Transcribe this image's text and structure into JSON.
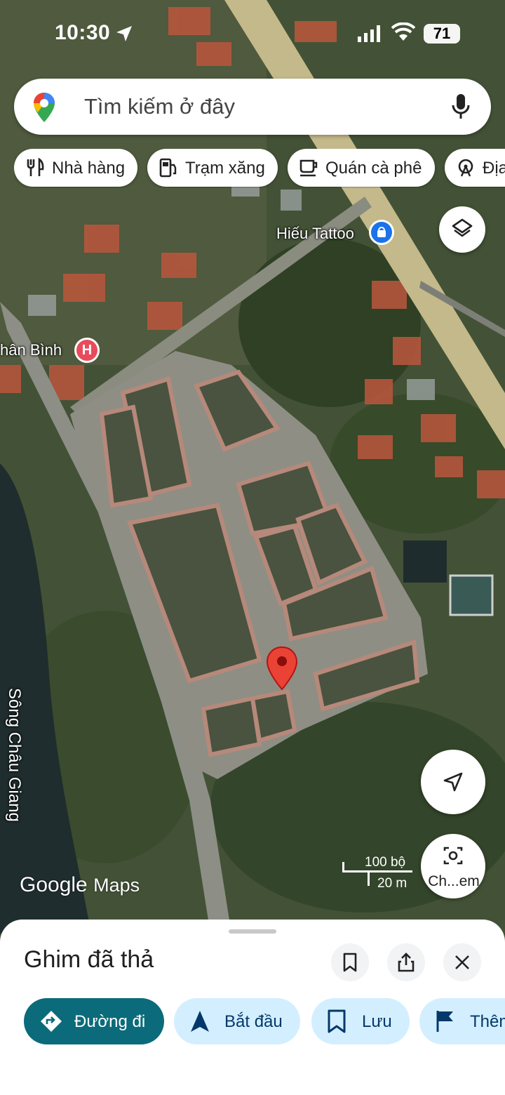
{
  "status_bar": {
    "time": "10:30",
    "battery": "71"
  },
  "search": {
    "placeholder": "Tìm kiếm ở đây",
    "logo_icon": "google-maps-pin-icon",
    "voice_icon": "microphone-icon"
  },
  "chips": [
    {
      "label": "Nhà hàng",
      "icon": "fork-knife-icon"
    },
    {
      "label": "Trạm xăng",
      "icon": "gas-station-icon"
    },
    {
      "label": "Quán cà phê",
      "icon": "coffee-cup-icon"
    },
    {
      "label": "Địa",
      "icon": "ferris-wheel-icon"
    }
  ],
  "map": {
    "places": [
      {
        "label": "Hiếu Tattoo",
        "icon": "shopping-bag-icon",
        "color": "#1a73e8"
      },
      {
        "label": "hân Bình",
        "icon": "hospital-icon",
        "color": "#e94b5b"
      }
    ],
    "river_label": "Sông Châu Giang",
    "pin_color": "#ea4335",
    "logo": {
      "google": "Google",
      "maps": "Maps"
    },
    "scale": {
      "imperial": "100 bộ",
      "metric": "20 m"
    },
    "camera_label": "Ch...em"
  },
  "sheet": {
    "title": "Ghim đã thả",
    "actions": [
      {
        "label": "Đường đi",
        "icon": "directions-icon",
        "primary": true
      },
      {
        "label": "Bắt đầu",
        "icon": "navigation-arrow-icon"
      },
      {
        "label": "Lưu",
        "icon": "bookmark-icon"
      },
      {
        "label": "Thêm",
        "icon": "flag-icon"
      }
    ]
  },
  "colors": {
    "primary_action": "#0b6b7a",
    "secondary_action": "#d3efff",
    "pin": "#ea4335"
  }
}
